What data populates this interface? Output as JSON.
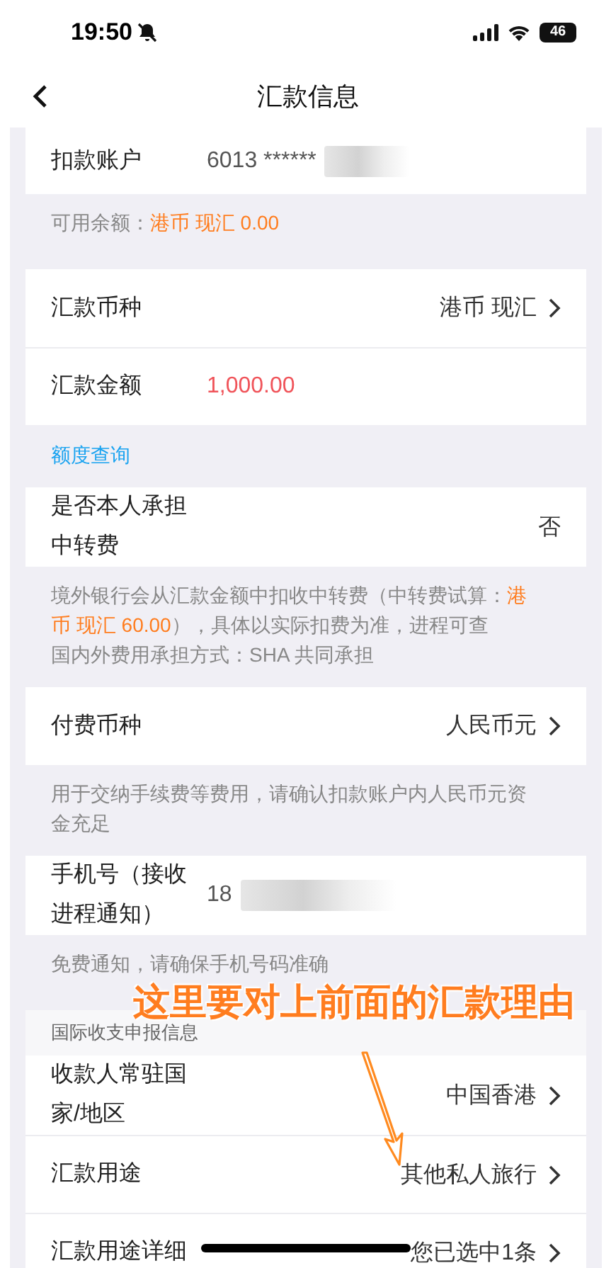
{
  "status_bar": {
    "time": "19:50",
    "battery": "46"
  },
  "nav": {
    "title": "汇款信息"
  },
  "blocks": [
    {
      "kind": "card",
      "rows": [
        {
          "kind": "masked",
          "label": "扣款账户",
          "value": "6013 ******"
        }
      ]
    },
    {
      "kind": "note",
      "paragraphs": [
        [
          {
            "text": "可用余额：",
            "highlight": false
          },
          {
            "text": "港币 现汇 0.00",
            "highlight": true
          }
        ]
      ]
    },
    {
      "kind": "card",
      "rows": [
        {
          "kind": "select",
          "label": "汇款币种",
          "value": "港币 现汇"
        },
        {
          "kind": "amount",
          "label": "汇款金额",
          "value": "1,000.00"
        }
      ]
    },
    {
      "kind": "link",
      "text": "额度查询"
    },
    {
      "kind": "card",
      "rows": [
        {
          "kind": "plain",
          "label": "是否本人承担中转费",
          "value": "否"
        }
      ]
    },
    {
      "kind": "note",
      "paragraphs": [
        [
          {
            "text": "境外银行会从汇款金额中扣收中转费（中转费试算：",
            "highlight": false
          },
          {
            "text": "港币 现汇 60.00",
            "highlight": true
          },
          {
            "text": "），具体以实际扣费为准，进程可查",
            "highlight": false
          }
        ],
        [
          {
            "text": "国内外费用承担方式：SHA 共同承担",
            "highlight": false
          }
        ]
      ]
    },
    {
      "kind": "card",
      "rows": [
        {
          "kind": "select",
          "label": "付费币种",
          "value": "人民币元"
        }
      ]
    },
    {
      "kind": "note",
      "paragraphs": [
        [
          {
            "text": "用于交纳手续费等费用，请确认扣款账户内人民币元资金充足",
            "highlight": false
          }
        ]
      ]
    },
    {
      "kind": "card",
      "rows": [
        {
          "kind": "masked",
          "label": "手机号（接收进程通知）",
          "value": "18"
        }
      ]
    },
    {
      "kind": "note",
      "paragraphs": [
        [
          {
            "text": "免费通知，请确保手机号码准确",
            "highlight": false
          }
        ]
      ]
    },
    {
      "kind": "header",
      "text": "国际收支申报信息"
    },
    {
      "kind": "card",
      "rows": [
        {
          "kind": "select",
          "label": "收款人常驻国家/地区",
          "value": "中国香港"
        },
        {
          "kind": "select",
          "label": "汇款用途",
          "value": "其他私人旅行"
        },
        {
          "kind": "select",
          "label": "汇款用途详细",
          "value": "您已选中1条"
        }
      ]
    }
  ],
  "annotation": {
    "text": "这里要对上前面的汇款理由"
  }
}
